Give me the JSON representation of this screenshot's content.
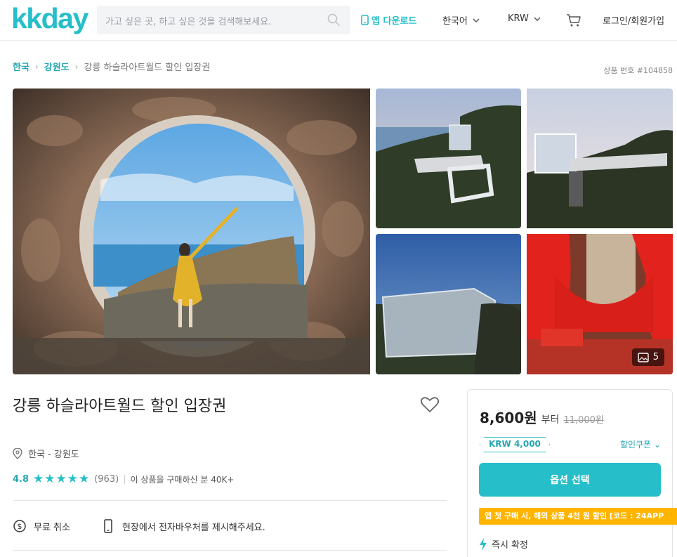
{
  "header": {
    "logo": "kkday",
    "search_placeholder": "가고 싶은 곳, 하고 싶은 것을 검색해보세요.",
    "app_download": "앱 다운로드",
    "language": "한국어",
    "currency": "KRW",
    "login": "로그인/회원가입"
  },
  "breadcrumb": {
    "items": [
      "한국",
      "강원도"
    ],
    "current": "강릉 하슬라아트월드 할인 입장권"
  },
  "product_no": "상품 번호 #104858",
  "gallery": {
    "photo_count": "5"
  },
  "product": {
    "title": "강릉 하슬라아트월드 할인 입장권",
    "location": "한국 - 강원도",
    "rating": "4.8",
    "stars": "★★★★★",
    "review_count": "(963)",
    "bought": "이 상품을 구매하신 분 40K+",
    "features": [
      {
        "icon": "dollar-cancel-icon",
        "label": "무료 취소"
      },
      {
        "icon": "mobile-voucher-icon",
        "label": "현장에서 전자바우처를 제시해주세요."
      }
    ]
  },
  "price_card": {
    "price": "8,600원",
    "from": "부터",
    "original": "11,000원",
    "coupon_tag": "KRW 4,000",
    "coupon_link": "할인쿠폰",
    "option_button": "옵션 선택",
    "promo": "앱 첫 구매 시, 해외 상품 4천 원 할인 [코드 : 24APP",
    "instant": "즉시 확정"
  },
  "colors": {
    "brand": "#26bec9",
    "promo": "#ffb400"
  }
}
